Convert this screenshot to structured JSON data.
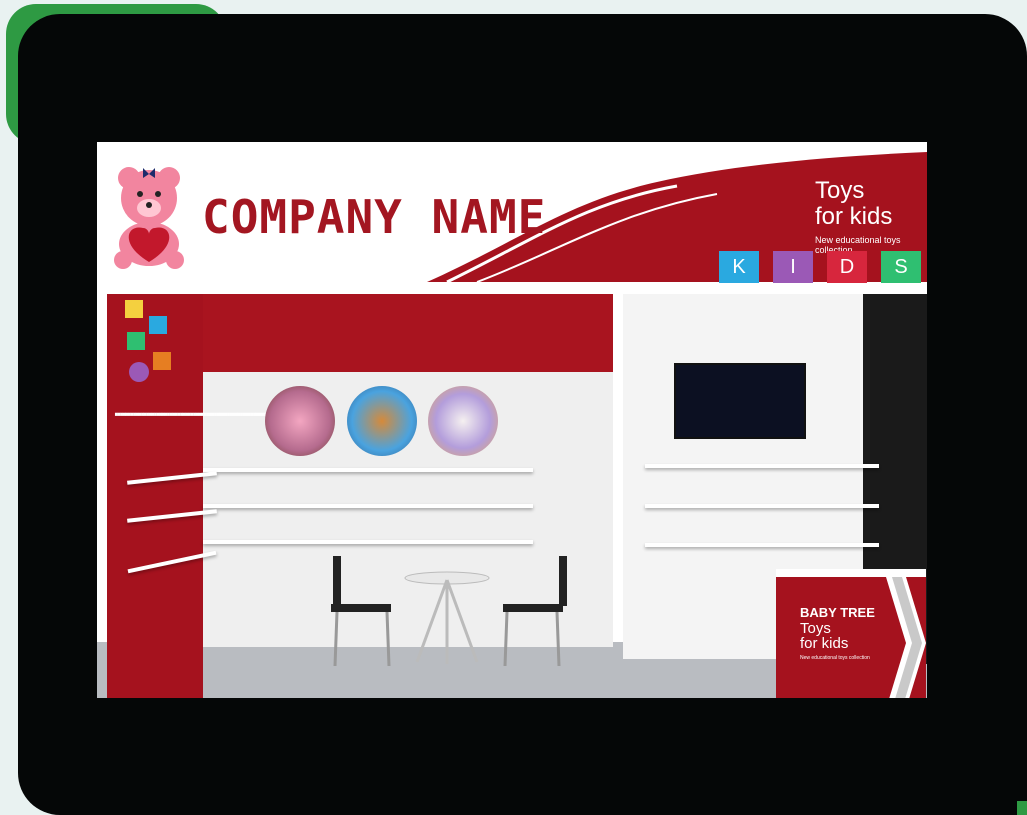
{
  "header": {
    "company_name": "COMPANY NAME",
    "toys_line1": "Toys",
    "toys_line2": "for kids",
    "subtitle": "New educational toys collection"
  },
  "kids_blocks": [
    {
      "letter": "K",
      "color": "#2aa9e0"
    },
    {
      "letter": "I",
      "color": "#9b59b6"
    },
    {
      "letter": "D",
      "color": "#d7263d"
    },
    {
      "letter": "S",
      "color": "#2fbf71"
    }
  ],
  "counter": {
    "brand": "BABY TREE",
    "line1": "Toys",
    "line2": "for kids",
    "subtitle": "New educational toys collection"
  },
  "colors": {
    "accent_red": "#a5121e",
    "frame_black": "#050707",
    "tab_green": "#2e9a43"
  }
}
